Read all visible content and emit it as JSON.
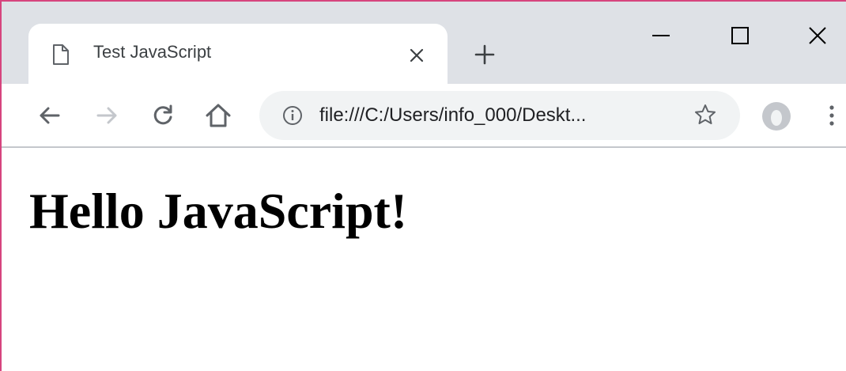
{
  "tab": {
    "title": "Test JavaScript",
    "icon": "document-icon"
  },
  "window_controls": {
    "minimize_icon": "minimize-icon",
    "maximize_icon": "maximize-icon",
    "close_icon": "close-icon"
  },
  "toolbar": {
    "back_icon": "arrow-left-icon",
    "forward_icon": "arrow-right-icon",
    "reload_icon": "reload-icon",
    "home_icon": "home-icon",
    "url": "file:///C:/Users/info_000/Deskt...",
    "info_icon": "info-icon",
    "bookmark_icon": "star-icon",
    "menu_icon": "more-vertical-icon"
  },
  "page": {
    "heading": "Hello JavaScript!"
  },
  "colors": {
    "tabstrip": "#dee1e6",
    "omnibox": "#f1f3f4",
    "window_border": "#d6447e",
    "icon": "#5f6368",
    "icon_disabled": "#c4c7cc"
  }
}
